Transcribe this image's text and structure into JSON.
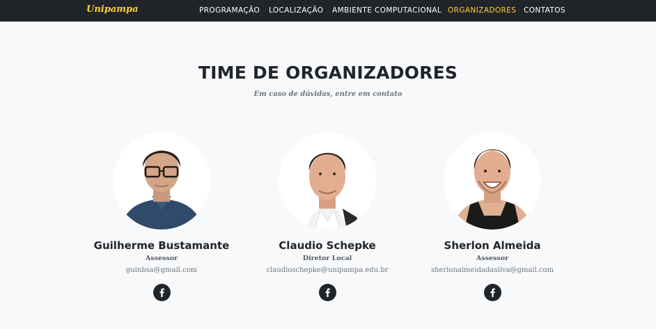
{
  "navbar": {
    "brand": "Unipampa",
    "links": [
      {
        "label": "PROGRAMAÇÃO",
        "active": false
      },
      {
        "label": "LOCALIZAÇÃO",
        "active": false
      },
      {
        "label": "AMBIENTE COMPUTACIONAL",
        "active": false
      },
      {
        "label": "ORGANIZADORES",
        "active": true
      },
      {
        "label": "CONTATOS",
        "active": false
      }
    ]
  },
  "team": {
    "heading": "TIME DE ORGANIZADORES",
    "subheading": "Em caso de dúvidas, entre em contato",
    "members": [
      {
        "name": "Guilherme Bustamante",
        "role": "Assessor",
        "email": "guinbsa@gmail.com",
        "social_icon": "facebook-icon"
      },
      {
        "name": "Claudio Schepke",
        "role": "Diretor Local",
        "email": "claudioschepke@unipampa.edu.br",
        "social_icon": "facebook-icon"
      },
      {
        "name": "Sherlon Almeida",
        "role": "Assessor",
        "email": "sherlonalmeidadasilva@gmail.com",
        "social_icon": "facebook-icon"
      }
    ]
  },
  "colors": {
    "navbar_bg": "#212529",
    "accent": "#fed136",
    "page_bg": "#f8f9fa",
    "text_dark": "#212529",
    "text_muted": "#6c757d"
  }
}
